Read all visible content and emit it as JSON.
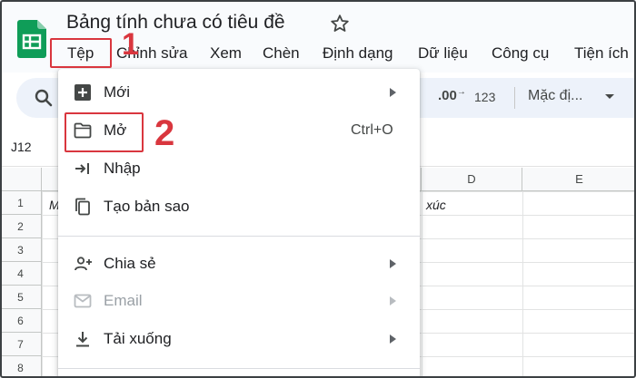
{
  "app": {
    "document_title": "Bảng tính chưa có tiêu đề",
    "logo_icon": "sheets-logo-icon",
    "star_icon": "star-outline-icon"
  },
  "menubar": {
    "items": [
      {
        "label": "Tệp"
      },
      {
        "label": "Chỉnh sửa"
      },
      {
        "label": "Xem"
      },
      {
        "label": "Chèn"
      },
      {
        "label": "Định dạng"
      },
      {
        "label": "Dữ liệu"
      },
      {
        "label": "Công cụ"
      },
      {
        "label": "Tiện ích"
      }
    ]
  },
  "toolbar": {
    "decimal_label": ".00",
    "decimal_sup": "→",
    "number_format_label": "123",
    "font_label": "Mặc đị..."
  },
  "formula_bar": {
    "name_box": "J12"
  },
  "grid": {
    "column_headers": [
      "D",
      "E"
    ],
    "row_headers": [
      "1",
      "2",
      "3",
      "4",
      "5",
      "6",
      "7",
      "8"
    ],
    "cells": {
      "A1_partial": "M",
      "D1": "xúc"
    }
  },
  "file_menu": {
    "items": [
      {
        "label": "Mới",
        "icon": "new-sheet-icon",
        "submenu": true
      },
      {
        "label": "Mở",
        "icon": "folder-icon",
        "shortcut": "Ctrl+O"
      },
      {
        "label": "Nhập",
        "icon": "import-icon"
      },
      {
        "label": "Tạo bản sao",
        "icon": "copy-icon"
      },
      {
        "label": "Chia sẻ",
        "icon": "share-person-icon",
        "submenu": true
      },
      {
        "label": "Email",
        "icon": "email-icon",
        "submenu": true,
        "disabled": true
      },
      {
        "label": "Tải xuống",
        "icon": "download-icon",
        "submenu": true
      }
    ]
  },
  "annotations": {
    "step1": "1",
    "step2": "2",
    "color": "#d9363e"
  },
  "colors": {
    "header_bg": "#f9fbfd",
    "toolbar_bg": "#edf2fa",
    "sheets_green": "#0f9d58"
  }
}
